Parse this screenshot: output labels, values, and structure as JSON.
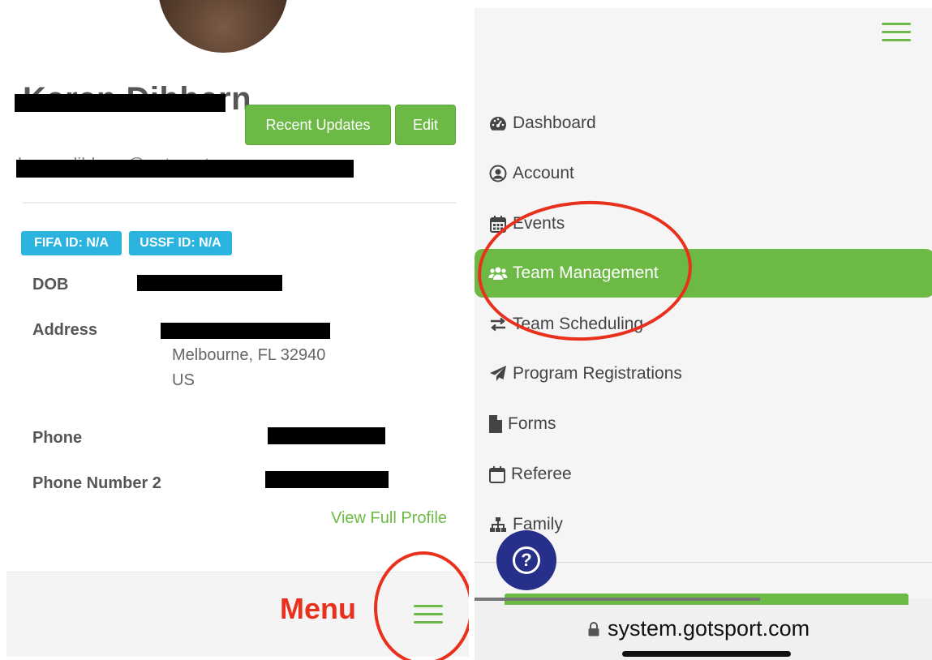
{
  "profile": {
    "name": "Karen Dibbern",
    "email": "karen.dibbern@gotsport.org",
    "recent_updates_label": "Recent Updates",
    "edit_label": "Edit",
    "fifa_badge": "FIFA ID: N/A",
    "ussf_badge": "USSF ID: N/A",
    "dob_label": "DOB",
    "address_label": "Address",
    "address_line2": "Melbourne, FL 32940",
    "address_line3": "US",
    "phone_label": "Phone",
    "phone2_label": "Phone Number 2",
    "view_full_profile": "View Full Profile",
    "menu_annotation": "Menu"
  },
  "nav": {
    "items": [
      {
        "label": "Dashboard",
        "icon": "dashboard-icon"
      },
      {
        "label": "Account",
        "icon": "user-circle-icon"
      },
      {
        "label": "Events",
        "icon": "calendar-icon"
      },
      {
        "label": "Team Management",
        "icon": "users-icon",
        "active": true
      },
      {
        "label": "Team Scheduling",
        "icon": "exchange-icon"
      },
      {
        "label": "Program Registrations",
        "icon": "paper-plane-icon"
      },
      {
        "label": "Forms",
        "icon": "file-icon"
      },
      {
        "label": "Referee",
        "icon": "calendar-outline-icon"
      },
      {
        "label": "Family",
        "icon": "sitemap-icon"
      }
    ]
  },
  "browser": {
    "url": "system.gotsport.com"
  },
  "colors": {
    "accent_green": "#6cba45",
    "annotation_red": "#e8301d",
    "badge_blue": "#2bb3e0",
    "help_button": "#262f8a"
  }
}
